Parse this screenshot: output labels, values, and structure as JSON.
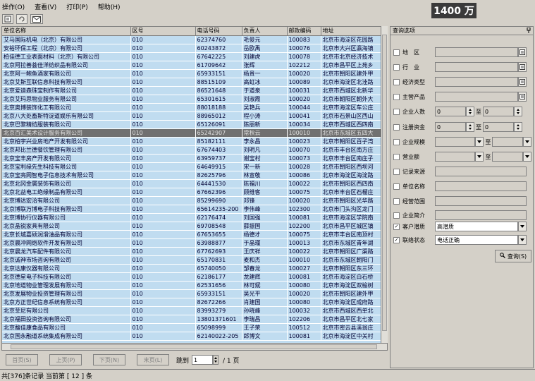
{
  "menu": [
    "操作(O)",
    "查看(V)",
    "打印(P)",
    "帮助(H)"
  ],
  "counter": "1400 万",
  "grid": {
    "columns": [
      "单位名称",
      "区号",
      "电话号码",
      "负责人",
      "邮政编码",
      "地址"
    ],
    "rows": [
      [
        "艾马国际机电（北京）有限公司",
        "010",
        "62374760",
        "毛俊元",
        "100083",
        "北京市海淀区花园路"
      ],
      [
        "安裕环保工程（北京）有限公司",
        "010",
        "60243872",
        "岳欧禹",
        "100076",
        "北京市大兴区瀛海镇"
      ],
      [
        "柏佳德工业表面材料（北京）有限公司",
        "010",
        "67642225",
        "刘建虎",
        "100078",
        "北京市北京经济技术"
      ],
      [
        "北京阿拉善荟佳洋纺织品有限公司",
        "010",
        "61709642",
        "张辉",
        "102212",
        "北京市昌平区上苑乡"
      ],
      [
        "北京阿一鲍鱼酒家有限公司",
        "010",
        "65933151",
        "杨贵一",
        "100020",
        "北京市朝阳区建外甲"
      ],
      [
        "北京艾斯互联信息科技有限公司",
        "010",
        "88515109",
        "高虹冰",
        "100089",
        "北京市海淀区北洼路"
      ],
      [
        "北京爱迪森珠宝制作有限公司",
        "010",
        "86521648",
        "于道泉",
        "100031",
        "北京市西城区北新华"
      ],
      [
        "北京艾玛思物业服务有限公司",
        "010",
        "65301615",
        "刘淑霞",
        "100020",
        "北京市朝阳区朝外大"
      ],
      [
        "北京奥博装饰化工有限公司",
        "010",
        "88018188",
        "吴艳兵",
        "100044",
        "北京市海淀区车公庄"
      ],
      [
        "北京八大处畜斯特淀道娱乐有限公司",
        "010",
        "88965012",
        "程小涛",
        "100041",
        "北京市石景山区西山"
      ],
      [
        "北京巴黎精纺服装有限公司",
        "010",
        "65126091",
        "陈丽新",
        "100034",
        "北京市西城区西四南"
      ],
      [
        "北京百汇美术设计服务有限公司",
        "010",
        "65242907",
        "常秋云",
        "100010",
        "北京市东城区五四大"
      ],
      [
        "北京柏宇兴业房地产开发有限公司",
        "010",
        "85182111",
        "李永昌",
        "100023",
        "北京市朝阳区百子湾"
      ],
      [
        "北京邦比兰德餐饮管理有限公司",
        "010",
        "67674403",
        "刘明凡",
        "100070",
        "北京市丰台区南方庄"
      ],
      [
        "北京宝丰房产开发有限公司",
        "010",
        "63959737",
        "谢宝村",
        "100073",
        "北京市丰台区南庄子"
      ],
      [
        "北京宝利缘先生科技有限公司",
        "010",
        "64649915",
        "宋一新",
        "100028",
        "北京市朝阳区西坝河"
      ],
      [
        "北京宝亮网智电子信息技术有限公司",
        "010",
        "82625796",
        "林宣敬",
        "100086",
        "北京市海淀区海淀路"
      ],
      [
        "北京北冈金属装饰有限公司",
        "010",
        "64441530",
        "陈福川",
        "100022",
        "北京市朝阳区西四南"
      ],
      [
        "北京北益电工绝缘制品有限公司",
        "010",
        "67662396",
        "顾维客",
        "100075",
        "北京市丰台区石榴庄"
      ],
      [
        "北京博达宏洽有限公司",
        "010",
        "85299690",
        "邓锋",
        "100020",
        "北京市朝阳区光华路"
      ],
      [
        "北京博联万博电子科技有限公司",
        "010",
        "65614235-200",
        "李伟峰",
        "102300",
        "北京市门头沟区龙门"
      ],
      [
        "北京博协行仪器有限公司",
        "010",
        "62176474",
        "刘国强",
        "100081",
        "北京市海淀区学院南"
      ],
      [
        "北京晶锐家具有限公司",
        "010",
        "69708548",
        "薛振国",
        "102200",
        "北京市昌平区城区镇"
      ],
      [
        "北京长城嘉硕润滑油品有限公司",
        "010",
        "67653655",
        "杨德才",
        "100075",
        "北京市丰台区南顶村"
      ],
      [
        "北京晨冲网络软件开发有限公司",
        "010",
        "63988877",
        "于晶瑾",
        "100013",
        "北京市东城区青年湖"
      ],
      [
        "北京晨龙汽车配件有限公司",
        "010",
        "67762693",
        "王庆祥",
        "100022",
        "北京市朝阳区广渠路"
      ],
      [
        "北京诚神市场咨询有限公司",
        "010",
        "65170831",
        "麦和杰",
        "100010",
        "北京市东城区朝阳门"
      ],
      [
        "北京达康仪器有限公司",
        "010",
        "65740050",
        "邹春龙",
        "100027",
        "北京市朝阳区东三环"
      ],
      [
        "北京德星电子科技有限公司",
        "010",
        "62186177",
        "龙建辉",
        "100081",
        "北京市海淀区白石桥"
      ],
      [
        "北京地道物业管理发展有限公司",
        "010",
        "62531656",
        "林可斌",
        "100080",
        "北京市海淀区双榆树"
      ],
      [
        "北京发展物业投资管理有限公司",
        "010",
        "65933151",
        "吴光平",
        "100020",
        "北京市朝阳区建外甲"
      ],
      [
        "北京方正世纪信息系统有限公司",
        "010",
        "82672266",
        "肖建国",
        "100080",
        "北京市海淀区成府路"
      ],
      [
        "北京菲尼有限公司",
        "010",
        "83993279",
        "孙晓峰",
        "100032",
        "北京市西城区西单北"
      ],
      [
        "北京福田投资咨询有限公司",
        "010",
        "13801371601",
        "李瑞昌",
        "102206",
        "北京市昌平区北七家"
      ],
      [
        "北京馥佳康食品有限公司",
        "010",
        "65098999",
        "王子荣",
        "100512",
        "北京市密云县溪翁庄"
      ],
      [
        "北京国永融道系统集成有限公司",
        "010",
        "62140022-205",
        "郎博文",
        "100081",
        "北京市海淀区中关村"
      ]
    ],
    "selected_index": 11
  },
  "pager": {
    "first": "首页(S)",
    "prev": "上页(P)",
    "next": "下页(N)",
    "last": "末页(L)",
    "jump_label": "跳到",
    "page_value": "1",
    "total_pages": "/ 1 页"
  },
  "status": "共[376]条记录  当前第 [ 12 ] 条",
  "panel": {
    "title": "查询选项",
    "pin": "ᵖ",
    "fields": [
      {
        "label": "地　区",
        "checked": false,
        "kind": "lookup",
        "value": ""
      },
      {
        "label": "行　业",
        "checked": false,
        "kind": "lookup",
        "value": ""
      },
      {
        "label": "经济类型",
        "checked": false,
        "kind": "lookup",
        "value": ""
      },
      {
        "label": "主营产品",
        "checked": false,
        "kind": "lookup",
        "value": ""
      },
      {
        "label": "企业人数",
        "checked": false,
        "kind": "range",
        "from": "0",
        "sep": "至",
        "to": "0"
      },
      {
        "label": "注册资金",
        "checked": false,
        "kind": "range",
        "from": "0",
        "sep": "至",
        "to": "0"
      },
      {
        "label": "企业规模",
        "checked": false,
        "kind": "range-select",
        "from": "",
        "sep": "至",
        "to": ""
      },
      {
        "label": "营业额",
        "checked": false,
        "kind": "range-select",
        "from": "",
        "sep": "至",
        "to": ""
      },
      {
        "label": "记录来源",
        "checked": false,
        "kind": "text",
        "value": ""
      },
      {
        "label": "单位名称",
        "checked": false,
        "kind": "text",
        "value": ""
      },
      {
        "label": "经营范围",
        "checked": false,
        "kind": "text",
        "value": ""
      },
      {
        "label": "企业简介",
        "checked": false,
        "kind": "text",
        "value": ""
      },
      {
        "label": "客户潜质",
        "checked": true,
        "kind": "select",
        "value": "高潜质"
      },
      {
        "label": "联络状态",
        "checked": true,
        "kind": "select",
        "value": "电话正确"
      }
    ],
    "query_button": "查询(S)"
  },
  "icons": {
    "lookup": "lookup-icon",
    "dropdown": "dropdown-arrow-icon",
    "spin": "spin-updown-icon",
    "check": "✓"
  }
}
